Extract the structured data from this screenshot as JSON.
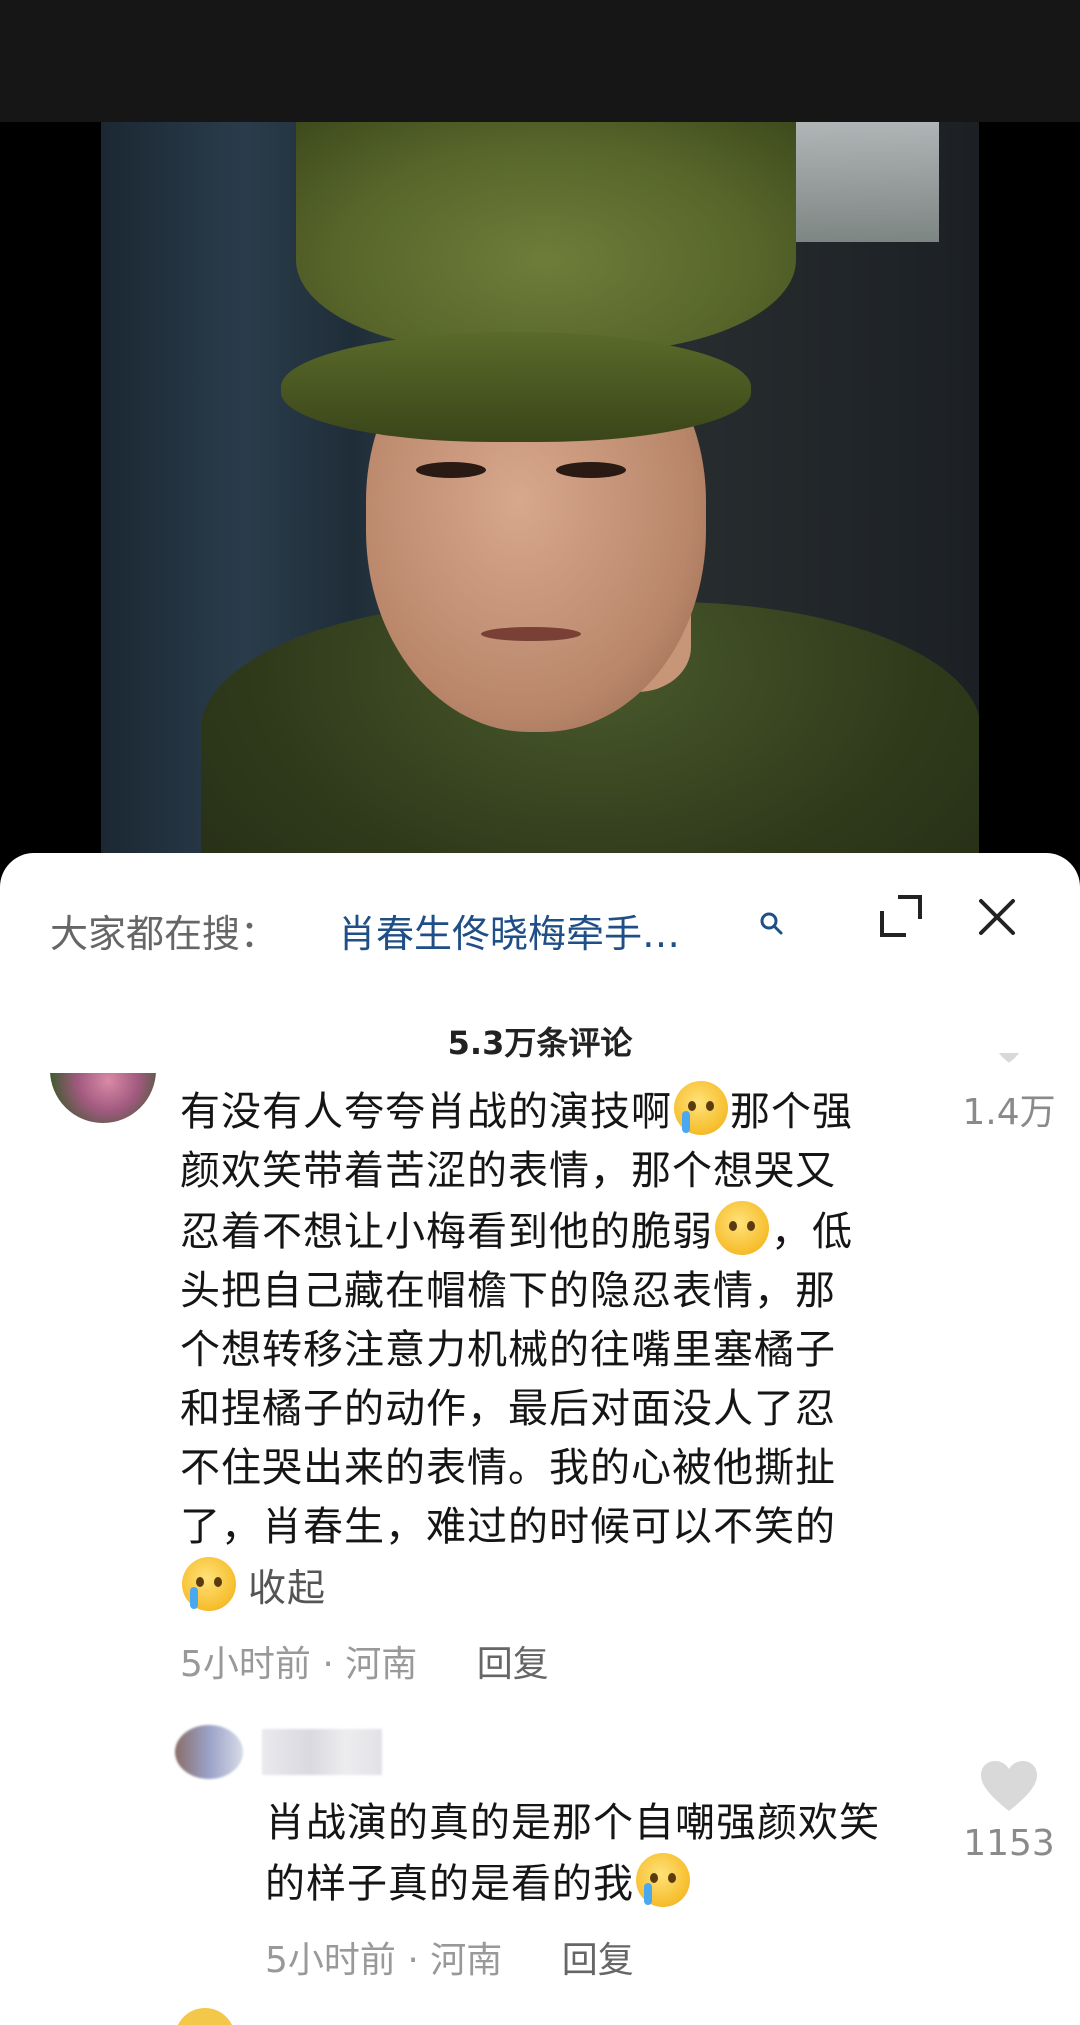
{
  "search": {
    "prefix": "大家都在搜：",
    "query": "肖春生佟晓梅牵手…"
  },
  "comments_count": "5.3万条评论",
  "comment": {
    "text_lines": [
      "有没有人夸夸肖战的演技啊",
      "那个强",
      "颜欢笑带着苦涩的表情，那个想哭又",
      "忍着不想让小梅看到他的脆弱",
      "，低",
      "头把自己藏在帽檐下的隐忍表情，那",
      "个想转移注意力机械的往嘴里塞橘子",
      "和捏橘子的动作，最后对面没人了忍",
      "不住哭出来的表情。我的心被他撕扯",
      "了，肖春生，难过的时候可以不笑的"
    ],
    "collapse": "收起",
    "time": "5小时前",
    "location": "河南",
    "reply": "回复",
    "likes": "1.4万"
  },
  "sub_comment": {
    "text_line1": "肖战演的真的是那个自嘲强颜欢笑",
    "text_line2": "的样子真的是看的我",
    "time": "5小时前",
    "location": "河南",
    "reply": "回复",
    "likes": "1153"
  },
  "icons": {
    "search": "search-icon",
    "expand": "expand-icon",
    "close": "close-icon",
    "heart": "heart-icon",
    "emoji_cry": "loudly-crying-face",
    "emoji_plead": "pleading-face",
    "emoji_tears": "crying-face"
  },
  "colors": {
    "search_query": "#1f4f86",
    "meta": "#999999"
  }
}
